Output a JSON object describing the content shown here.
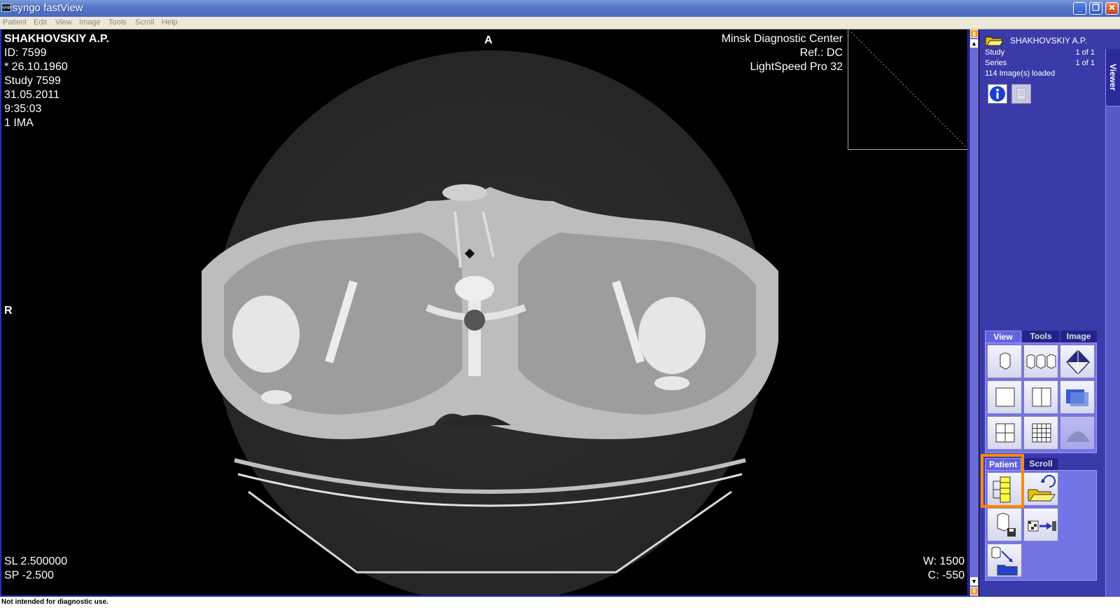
{
  "window": {
    "title": "syngo fastView",
    "logo_text": "syngo"
  },
  "menu": [
    "Patient",
    "Edit",
    "View",
    "Image",
    "Tools",
    "Scroll",
    "Help"
  ],
  "overlay": {
    "top_left": [
      "SHAKHOVSKIY A.P.",
      "ID: 7599",
      "* 26.10.1960",
      "Study 7599",
      "31.05.2011",
      "9:35:03",
      "1 IMA"
    ],
    "top_right": [
      "Minsk Diagnostic Center",
      "Ref.: DC",
      "LightSpeed Pro 32"
    ],
    "orientation_top": "A",
    "orientation_left": "R",
    "bottom_left": [
      "SL 2.500000",
      "SP -2.500"
    ],
    "bottom_right": [
      "W: 1500",
      "C: -550"
    ]
  },
  "panel": {
    "patient_name": "SHAKHOVSKIY A.P.",
    "study_label": "Study",
    "study_value": "1 of 1",
    "series_label": "Series",
    "series_value": "1 of 1",
    "loaded": "114 Image(s) loaded",
    "side_tab": "Viewer",
    "tabs_top": [
      "View",
      "Tools",
      "Image"
    ],
    "tabs_bottom": [
      "Patient",
      "Scroll"
    ]
  },
  "status": {
    "text": "Not intended for diagnostic use."
  },
  "colors": {
    "accent": "#ff8a00",
    "panel": "#3a3aa8",
    "viewer_border": "#2b2bd1"
  }
}
